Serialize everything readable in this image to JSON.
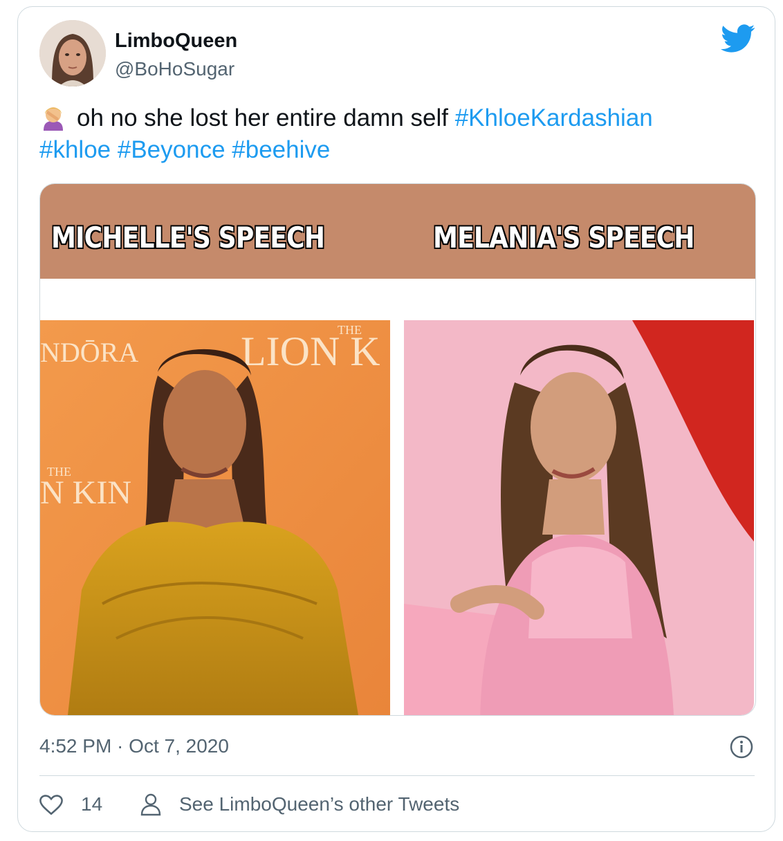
{
  "author": {
    "name": "LimboQueen",
    "handle": "@BoHoSugar",
    "avatar_icon": "avatar-photo"
  },
  "brand_icon": "twitter-bird-icon",
  "tweet": {
    "emoji": "face-palm",
    "text": "oh no she lost her entire damn self",
    "hashtags": [
      "#KhloeKardashian",
      "#khloe",
      "#Beyonce",
      "#beehive"
    ]
  },
  "media": {
    "left_label": "MICHELLE'S SPEECH",
    "right_label": "MELANIA'S SPEECH",
    "left_backdrop_text": [
      "NDŌRA",
      "THE",
      "LION K",
      "THE",
      "N KIN"
    ],
    "header_color": "#c58a6b"
  },
  "timestamp": "4:52 PM · Oct 7, 2020",
  "actions": {
    "like_count": "14",
    "see_other": "See LimboQueen’s other Tweets"
  },
  "colors": {
    "accent": "#1d9bf0",
    "muted": "#536471",
    "border": "#cfd9de"
  }
}
